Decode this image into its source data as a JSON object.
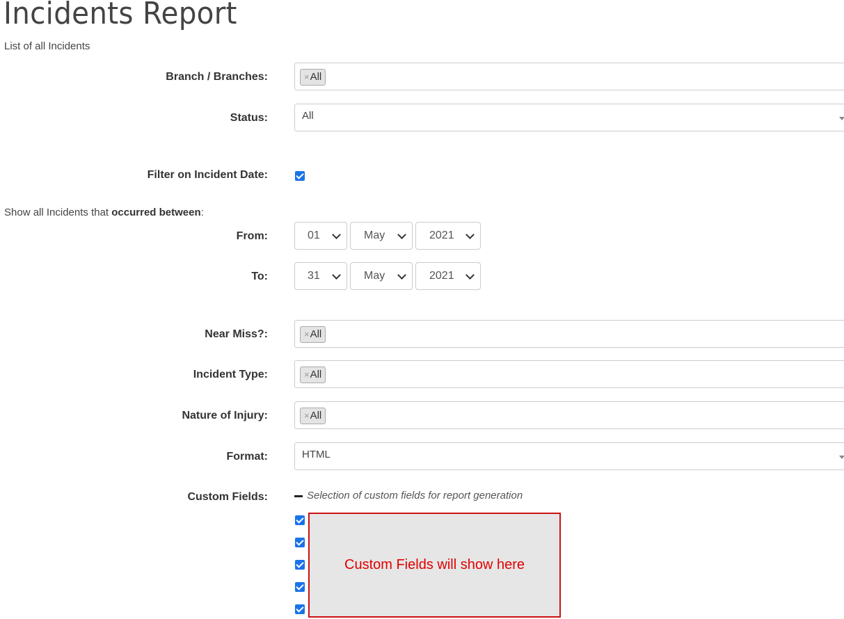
{
  "page": {
    "title": "Incidents Report",
    "subtitle": "List of all Incidents"
  },
  "form": {
    "branch": {
      "label": "Branch / Branches:",
      "chip_remove": "×",
      "chip": "All"
    },
    "status": {
      "label": "Status:",
      "value": "All"
    },
    "filter_date": {
      "label": "Filter on Incident Date:",
      "checked": true
    },
    "occurred": {
      "prefix": "Show all Incidents that ",
      "bold": "occurred between",
      "suffix": ":"
    },
    "from": {
      "label": "From:",
      "day": "01",
      "month": "May",
      "year": "2021"
    },
    "to": {
      "label": "To:",
      "day": "31",
      "month": "May",
      "year": "2021"
    },
    "near_miss": {
      "label": "Near Miss?:",
      "chip_remove": "×",
      "chip": "All"
    },
    "incident_type": {
      "label": "Incident Type:",
      "chip_remove": "×",
      "chip": "All"
    },
    "nature_of_injury": {
      "label": "Nature of Injury:",
      "chip_remove": "×",
      "chip": "All"
    },
    "format": {
      "label": "Format:",
      "value": "HTML"
    },
    "custom_fields": {
      "label": "Custom Fields:",
      "hint": "Selection of custom fields for report generation",
      "placeholder": "Custom Fields will show here",
      "checkbox_count": 5
    }
  },
  "colors": {
    "checkbox": "#1a73e8",
    "placeholder_border": "#cc1111",
    "placeholder_text": "#e00000",
    "placeholder_bg": "#e6e6e6"
  }
}
